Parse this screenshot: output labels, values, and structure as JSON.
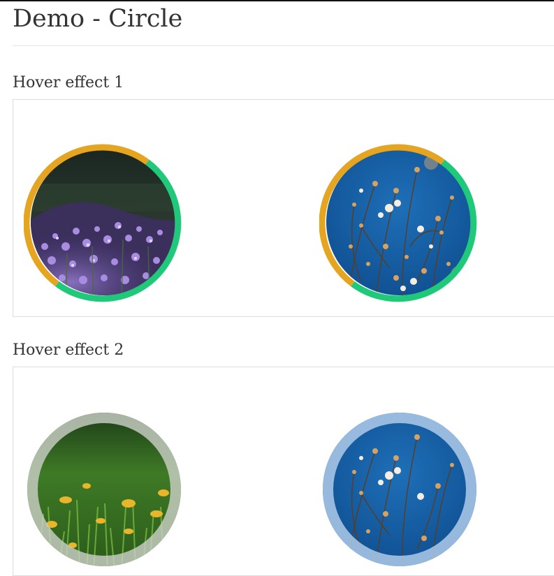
{
  "page": {
    "title": "Demo - Circle"
  },
  "sections": [
    {
      "heading": "Hover effect 1",
      "items": [
        {
          "image": "purple-flowers-photo",
          "ring_colors": [
            "#e6a520",
            "#20c97a"
          ]
        },
        {
          "image": "dried-flowers-on-blue-photo",
          "ring_colors": [
            "#e6a520",
            "#20c97a"
          ]
        }
      ]
    },
    {
      "heading": "Hover effect 2",
      "items": [
        {
          "image": "grass-with-yellow-leaves-photo",
          "ring_colors": [
            "#b9c0b6"
          ]
        },
        {
          "image": "dried-flowers-on-blue-photo",
          "ring_colors": [
            "#a9c4e2"
          ]
        }
      ]
    }
  ],
  "colors": {
    "ring_orange": "#e6a520",
    "ring_green": "#20c97a",
    "box_border": "#dddddd",
    "text": "#333333"
  }
}
